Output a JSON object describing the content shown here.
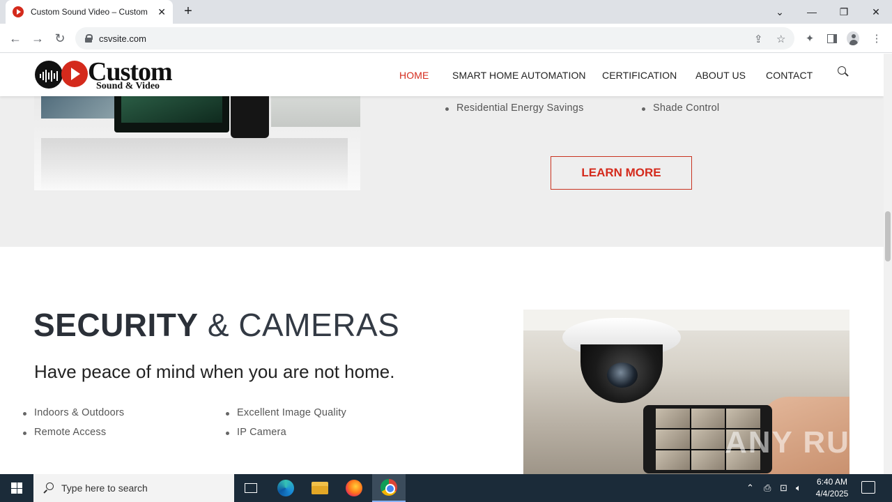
{
  "browser": {
    "tab_title": "Custom Sound Video – Custom",
    "tab_close": "✕",
    "new_tab": "+",
    "url": "csvsite.com",
    "window_controls": [
      "⌄",
      "—",
      "❐",
      "✕"
    ]
  },
  "site": {
    "logo_word": "Custom",
    "logo_sub": "Sound & Video",
    "nav": [
      {
        "label": "HOME",
        "active": true
      },
      {
        "label": "SMART HOME AUTOMATION",
        "active": false
      },
      {
        "label": "CERTIFICATION",
        "active": false
      },
      {
        "label": "ABOUT US",
        "active": false
      },
      {
        "label": "CONTACT",
        "active": false
      }
    ],
    "automation": {
      "bullets": [
        "Residential Energy Savings",
        "Shade Control"
      ],
      "learn_more": "LEARN MORE"
    },
    "security": {
      "title_strong": "SECURITY",
      "title_light": "& CAMERAS",
      "subtitle": "Have peace of mind when you are not home.",
      "bullets_left": [
        "Indoors & Outdoors",
        "Remote Access"
      ],
      "bullets_right": [
        "Excellent Image Quality",
        "IP Camera"
      ]
    },
    "watermark": "ANY RUN"
  },
  "taskbar": {
    "search_placeholder": "Type here to search",
    "time": "6:40 AM",
    "date": "4/4/2025"
  },
  "colors": {
    "accent": "#d42a1c",
    "grey_section": "#eeeeee",
    "taskbar": "#1b2b39"
  }
}
